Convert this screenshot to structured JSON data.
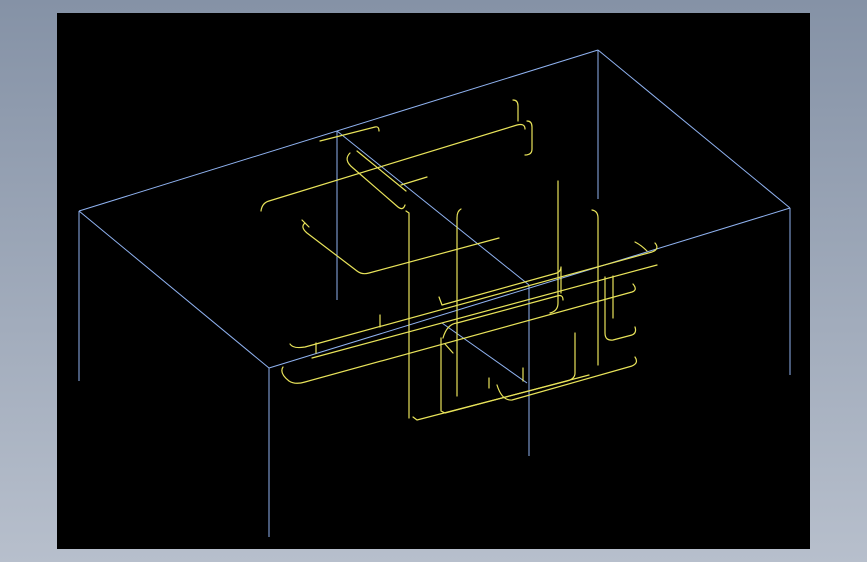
{
  "viewport": {
    "background": "#000000",
    "frame_color": "#8fb2f0",
    "rebar_color": "#e8e35a"
  }
}
